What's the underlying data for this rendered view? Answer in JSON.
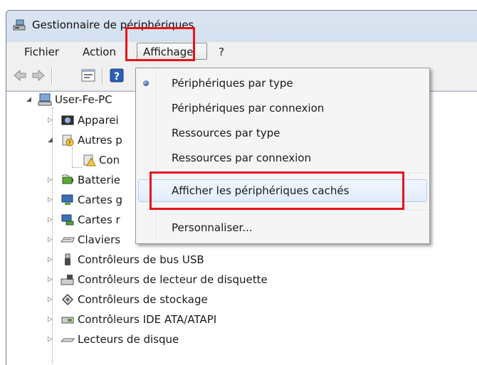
{
  "window": {
    "title": "Gestionnaire de périphériques"
  },
  "menubar": {
    "items": [
      "Fichier",
      "Action",
      "Affichage",
      "?"
    ]
  },
  "toolbar": {
    "buttons": [
      "back-icon",
      "forward-icon",
      "properties-icon",
      "help-icon"
    ]
  },
  "tree": {
    "root": "User-Fe-PC",
    "nodes": [
      {
        "label": "Apparei",
        "icon": "audio-devices-icon"
      },
      {
        "label": "Autres p",
        "icon": "other-devices-icon"
      },
      {
        "label": "Con",
        "icon": "unknown-device-icon"
      },
      {
        "label": "Batterie",
        "icon": "battery-icon"
      },
      {
        "label": "Cartes g",
        "icon": "display-adapter-icon"
      },
      {
        "label": "Cartes r",
        "icon": "network-adapter-icon"
      },
      {
        "label": "Claviers",
        "icon": "keyboard-icon"
      },
      {
        "label": "Contrôleurs de bus USB",
        "icon": "usb-icon"
      },
      {
        "label": "Contrôleurs de lecteur de disquette",
        "icon": "floppy-icon"
      },
      {
        "label": "Contrôleurs de stockage",
        "icon": "storage-icon"
      },
      {
        "label": "Contrôleurs IDE ATA/ATAPI",
        "icon": "ide-icon"
      },
      {
        "label": "Lecteurs de disque",
        "icon": "disk-drive-icon"
      }
    ]
  },
  "view_menu": {
    "items": [
      "Périphériques par type",
      "Périphériques par connexion",
      "Ressources par type",
      "Ressources par connexion",
      "Afficher les périphériques cachés",
      "Personnaliser..."
    ],
    "selected_index": 0,
    "highlighted_index": 4
  },
  "colors": {
    "highlight_box": "#e8131b",
    "window_frame": "#c9d7ea"
  }
}
